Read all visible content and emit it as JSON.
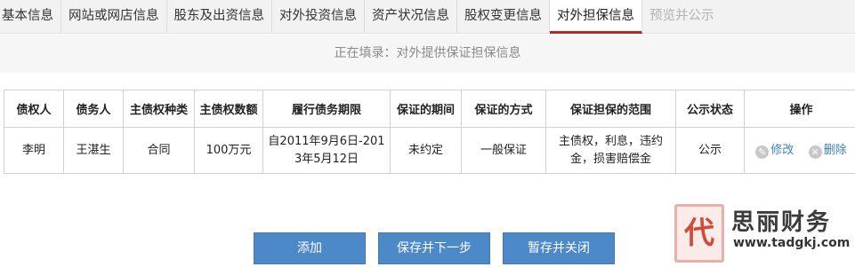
{
  "tabs": [
    {
      "label": "基本信息"
    },
    {
      "label": "网站或网店信息"
    },
    {
      "label": "股东及出资信息"
    },
    {
      "label": "对外投资信息"
    },
    {
      "label": "资产状况信息"
    },
    {
      "label": "股权变更信息"
    },
    {
      "label": "对外担保信息"
    },
    {
      "label": "预览并公示"
    }
  ],
  "status_text": "正在填录：对外提供保证担保信息",
  "table": {
    "headers": [
      "债权人",
      "债务人",
      "主债权种类",
      "主债权数额",
      "履行债务期限",
      "保证的期间",
      "保证的方式",
      "保证担保的范围",
      "公示状态",
      "操作"
    ],
    "rows": [
      {
        "creditor": "李明",
        "debtor": "王湛生",
        "claim_type": "合同",
        "claim_amount": "100万元",
        "term": "自2011年9月6日-2013年5月12日",
        "guarantee_period": "未约定",
        "guarantee_method": "一般保证",
        "guarantee_scope": "主债权，利息，违约金，损害赔偿金",
        "public_status": "公示",
        "edit_label": "修改",
        "delete_label": "删除"
      }
    ]
  },
  "buttons": {
    "add": "添加",
    "save_next": "保存并下一步",
    "save_close": "暂存并关闭"
  },
  "watermark": {
    "logo_char": "代",
    "brand": "思丽财务",
    "url": "www.tadgkj.com"
  },
  "colors": {
    "active_tab_underline": "#b02a2a",
    "button_bg": "#4d89c9",
    "link": "#3b7fc4"
  }
}
